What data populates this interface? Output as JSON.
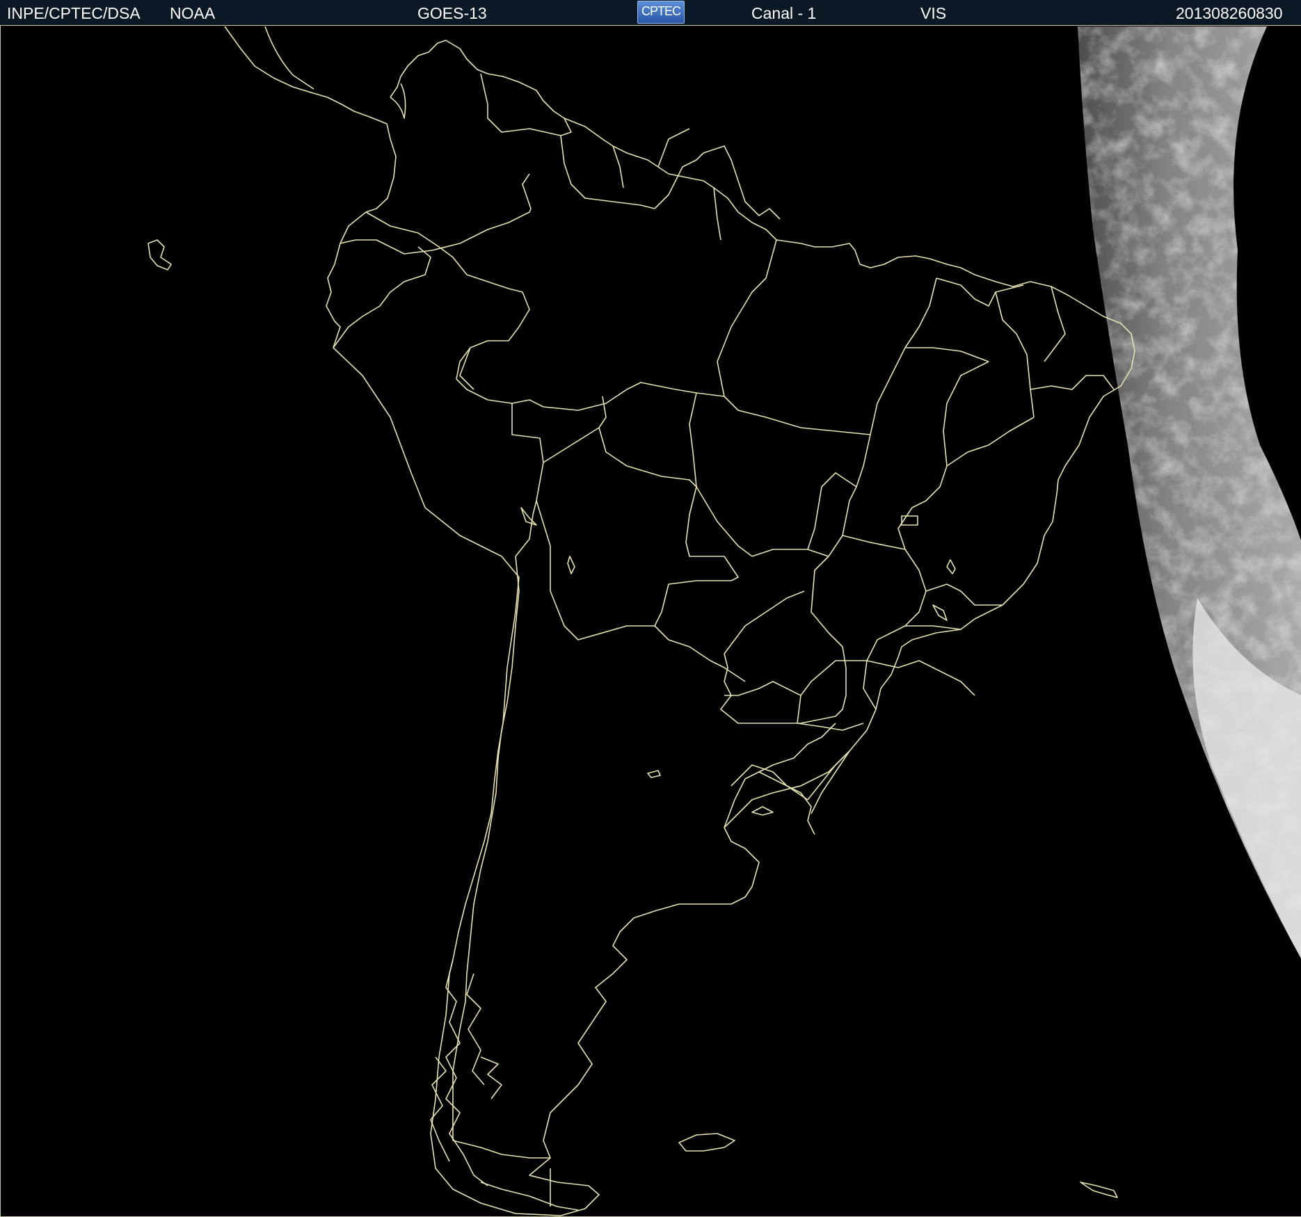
{
  "header": {
    "org": "INPE/CPTEC/DSA",
    "agency": "NOAA",
    "satellite": "GOES-13",
    "logo_text": "CPTEC",
    "channel": "Canal - 1",
    "band": "VIS",
    "timestamp": "201308260830"
  },
  "colors": {
    "background": "#000000",
    "header_bg": "#0b1825",
    "border_lines": "#e8e4b0",
    "header_text": "#ffffff"
  },
  "icons": {
    "logo": "cptec-logo"
  }
}
